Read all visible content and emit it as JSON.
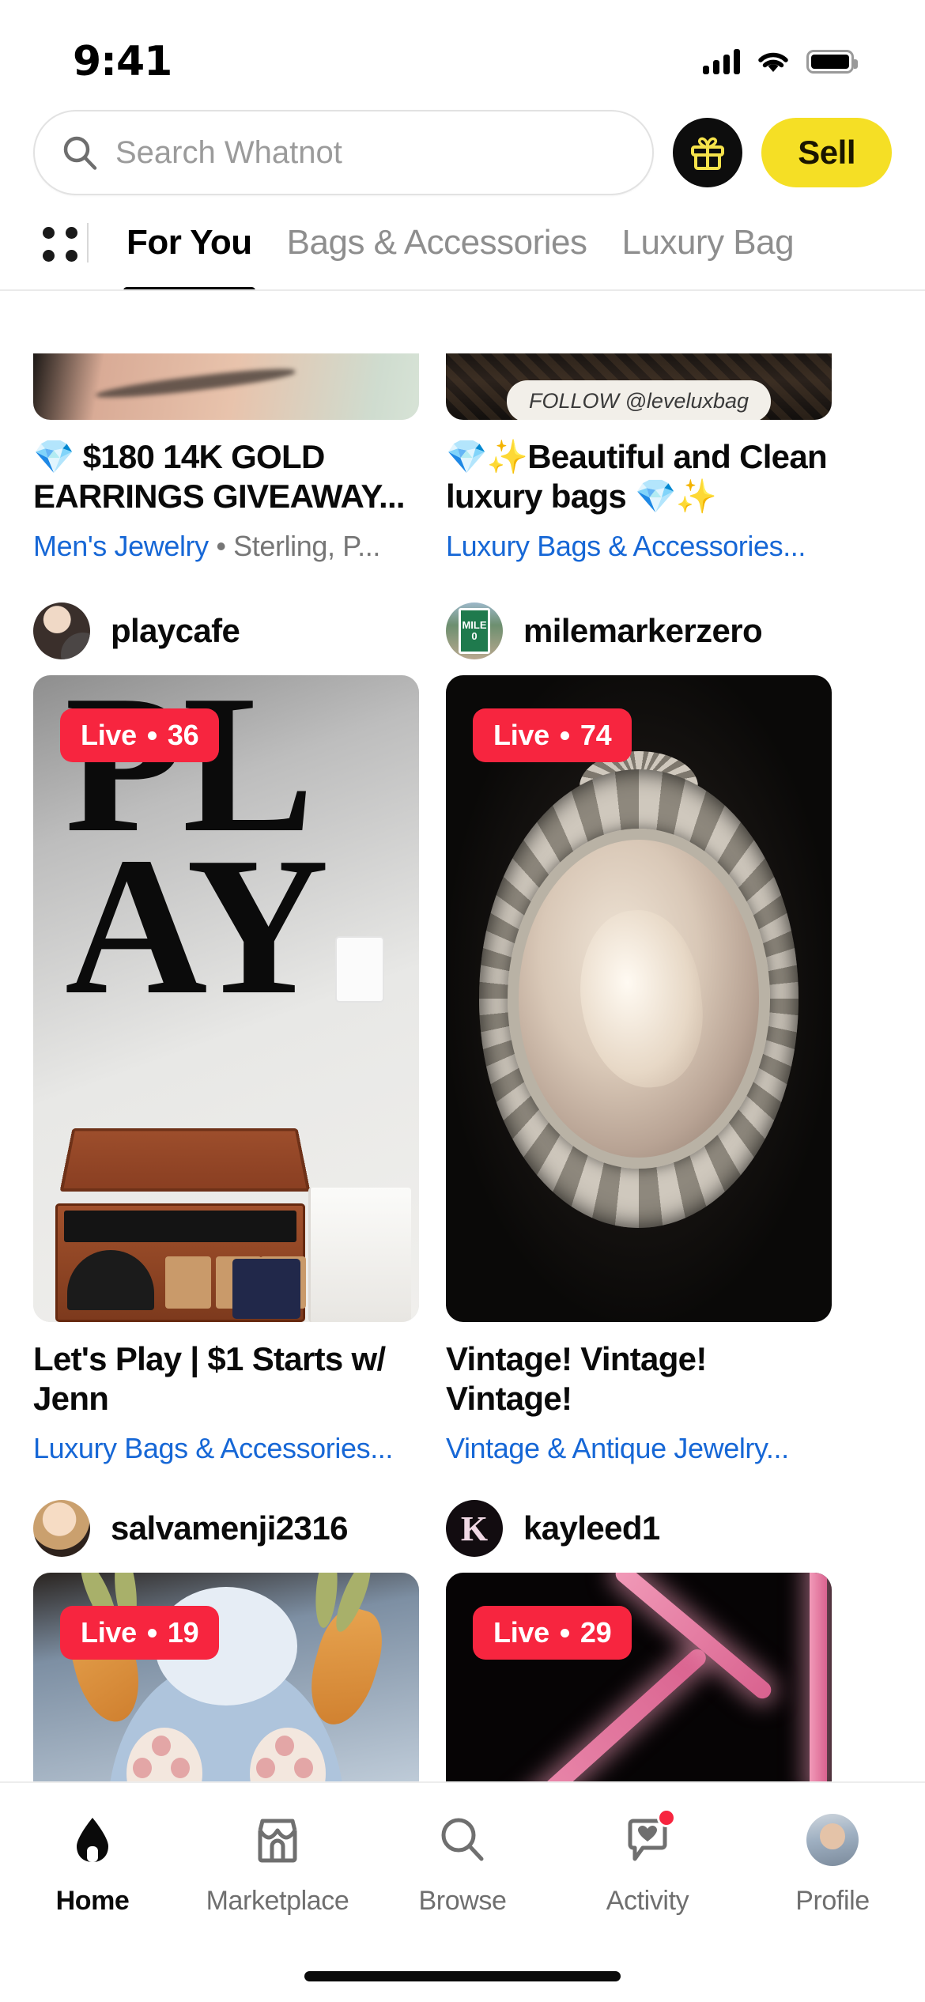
{
  "status_bar": {
    "time": "9:41",
    "signal_icon": "cellular-signal-icon",
    "wifi_icon": "wifi-icon",
    "battery_icon": "battery-icon"
  },
  "header": {
    "search_placeholder": "Search Whatnot",
    "search_value": "",
    "search_icon": "search-icon",
    "gift_icon": "gift-icon",
    "sell_label": "Sell",
    "accent_yellow": "#F5DF25",
    "gift_button_bg": "#0D0D0D"
  },
  "category_tabs": {
    "grid_icon": "grid-dots-icon",
    "items": [
      {
        "label": "For You",
        "active": true
      },
      {
        "label": "Bags & Accessories",
        "active": false
      },
      {
        "label": "Luxury Bag",
        "active": false
      }
    ]
  },
  "feed": {
    "live_badge_color": "#F7253F",
    "category_link_color": "#1667D6",
    "partial_row": [
      {
        "title": "💎 $180 14K GOLD EARRINGS GIVEAWAY...",
        "category": "Men's Jewelry",
        "category_suffix": " • Sterling, P...",
        "art": "brow"
      },
      {
        "title": "💎✨Beautiful and Clean luxury bags 💎✨",
        "category": "Luxury Bags & Accessories...",
        "category_suffix": "",
        "art": "bagdark",
        "overlay_pill": "FOLLOW @leveluxbag"
      }
    ],
    "rows": [
      {
        "cards": [
          {
            "seller": "playcafe",
            "avatar": "playcafe-avatar",
            "live_label": "Live",
            "live_count": "36",
            "title": "Let's Play | $1 Starts w/ Jenn",
            "category": "Luxury Bags & Accessories...",
            "art": "play"
          },
          {
            "seller": "milemarkerzero",
            "avatar": "milemarkerzero-avatar",
            "live_label": "Live",
            "live_count": "74",
            "title": "Vintage! Vintage! Vintage!",
            "category": "Vintage & Antique Jewelry...",
            "art": "cameo"
          }
        ]
      },
      {
        "cards": [
          {
            "seller": "salvamenji2316",
            "avatar": "salvamenji2316-avatar",
            "live_label": "Live",
            "live_count": "19",
            "title": "",
            "category": "",
            "art": "bunny"
          },
          {
            "seller": "kayleed1",
            "avatar": "kayleed1-avatar",
            "live_label": "Live",
            "live_count": "29",
            "title": "",
            "category": "",
            "art": "neon"
          }
        ]
      }
    ]
  },
  "bottom_nav": {
    "items": [
      {
        "label": "Home",
        "icon": "home-icon",
        "active": true,
        "badge": false
      },
      {
        "label": "Marketplace",
        "icon": "storefront-icon",
        "active": false,
        "badge": false
      },
      {
        "label": "Browse",
        "icon": "search-icon",
        "active": false,
        "badge": false
      },
      {
        "label": "Activity",
        "icon": "heart-chat-bubble-icon",
        "active": false,
        "badge": true
      },
      {
        "label": "Profile",
        "icon": "profile-avatar-icon",
        "active": false,
        "badge": false
      }
    ],
    "badge_color": "#F7253F"
  },
  "avatar_labels": {
    "milemarker_line1": "MILE",
    "milemarker_line2": "0",
    "kayleed_initial": "K"
  }
}
